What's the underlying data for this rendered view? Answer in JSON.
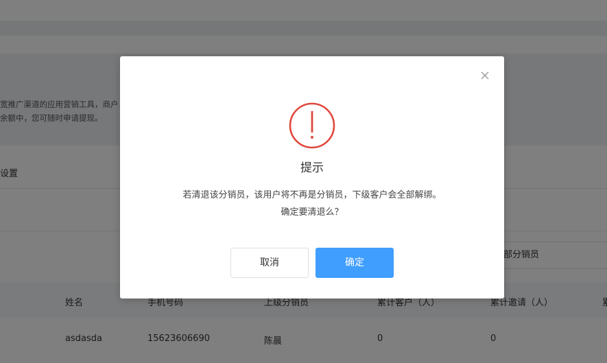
{
  "background": {
    "description_line1": "宽推广渠道的应用营销工具，商户",
    "description_line2": "余额中，您可随时申请提现。",
    "settings_title": "设置",
    "filter_value": "全部分销员",
    "table": {
      "headers": [
        "姓名",
        "手机号码",
        "上级分销员",
        "累计客户（人）",
        "累计邀请（人）",
        "累"
      ],
      "rows": [
        [
          "asdasda",
          "15623606690",
          "陈晨",
          "0",
          "0"
        ]
      ]
    }
  },
  "dialog": {
    "title": "提示",
    "message": "若清退该分销员，该用户将不再是分销员，下级客户会全部解绑。 确定要清退么？",
    "cancel_label": "取消",
    "confirm_label": "确定",
    "icon": "warning-circle-icon",
    "close_icon": "close-icon",
    "accent_color": "#409eff",
    "warning_color": "#e0483b"
  }
}
